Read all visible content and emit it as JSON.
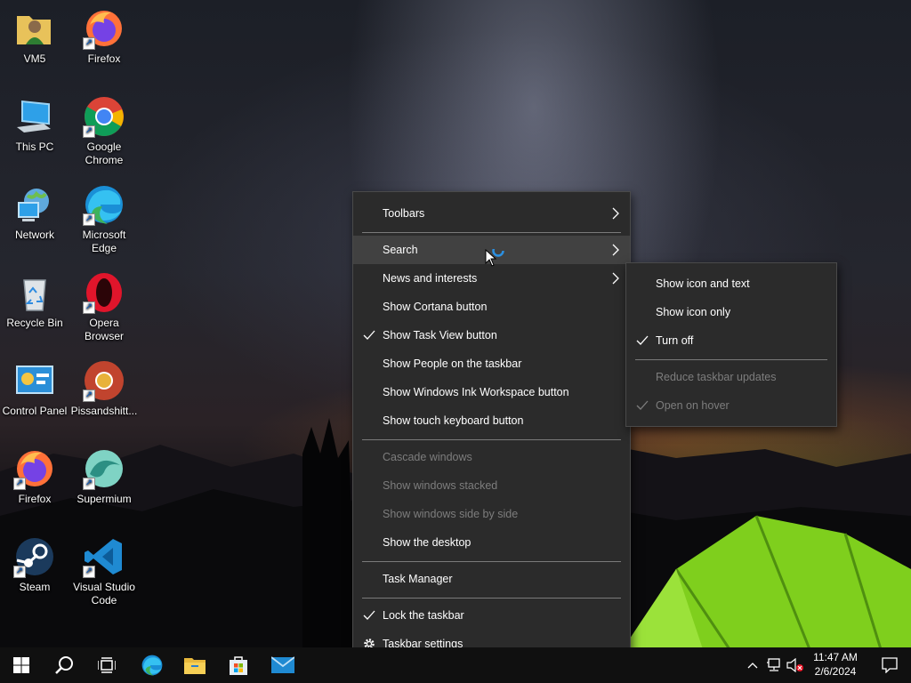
{
  "desktop": {
    "icons": [
      {
        "label": "VM5",
        "icon": "folder-user-icon"
      },
      {
        "label": "Firefox",
        "icon": "firefox-icon"
      },
      {
        "label": "This PC",
        "icon": "computer-icon"
      },
      {
        "label": "Google Chrome",
        "icon": "chrome-icon"
      },
      {
        "label": "Network",
        "icon": "network-icon"
      },
      {
        "label": "Microsoft Edge",
        "icon": "edge-icon"
      },
      {
        "label": "Recycle Bin",
        "icon": "recycle-bin-icon"
      },
      {
        "label": "Opera Browser",
        "icon": "opera-icon"
      },
      {
        "label": "Control Panel",
        "icon": "control-panel-icon"
      },
      {
        "label": "Pissandshitt...",
        "icon": "pissandshitt-icon"
      },
      {
        "label": "Firefox",
        "icon": "firefox-icon"
      },
      {
        "label": "Supermium",
        "icon": "supermium-icon"
      },
      {
        "label": "Steam",
        "icon": "steam-icon"
      },
      {
        "label": "Visual Studio Code",
        "icon": "vscode-icon"
      }
    ]
  },
  "context_menu": {
    "items": [
      {
        "label": "Toolbars",
        "submenu": true
      },
      {
        "label": "Search",
        "submenu": true,
        "highlighted": true
      },
      {
        "label": "News and interests",
        "submenu": true
      },
      {
        "label": "Show Cortana button"
      },
      {
        "label": "Show Task View button",
        "checked": true
      },
      {
        "label": "Show People on the taskbar"
      },
      {
        "label": "Show Windows Ink Workspace button"
      },
      {
        "label": "Show touch keyboard button"
      },
      {
        "label": "Cascade windows",
        "disabled": true
      },
      {
        "label": "Show windows stacked",
        "disabled": true
      },
      {
        "label": "Show windows side by side",
        "disabled": true
      },
      {
        "label": "Show the desktop"
      },
      {
        "label": "Task Manager"
      },
      {
        "label": "Lock the taskbar",
        "checked": true
      },
      {
        "label": "Taskbar settings",
        "icon": "gear-icon"
      }
    ]
  },
  "search_submenu": {
    "items": [
      {
        "label": "Show icon and text"
      },
      {
        "label": "Show icon only"
      },
      {
        "label": "Turn off",
        "checked": true
      },
      {
        "label": "Reduce taskbar updates",
        "disabled": true
      },
      {
        "label": "Open on hover",
        "disabled": true,
        "checked": true
      }
    ]
  },
  "taskbar": {
    "pinned": [
      "start-icon",
      "search-icon",
      "task-view-icon",
      "edge-icon",
      "file-explorer-icon",
      "microsoft-store-icon",
      "mail-icon"
    ],
    "clock": {
      "time": "11:47 AM",
      "date": "2/6/2024"
    }
  },
  "colors": {
    "menu_bg": "#2b2b2b",
    "menu_hover": "#414141",
    "disabled_text": "#7d7d7d",
    "taskbar_bg": "#101010",
    "accent_blue": "#0078d4"
  }
}
